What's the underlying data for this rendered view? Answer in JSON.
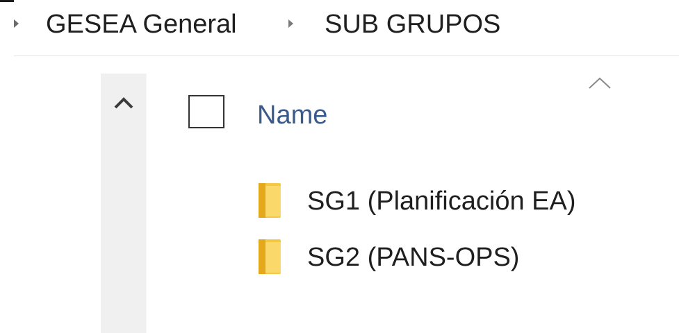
{
  "breadcrumb": {
    "items": [
      "GESEA General",
      "SUB GRUPOS"
    ]
  },
  "list": {
    "header": {
      "name_label": "Name"
    },
    "items": [
      {
        "name": "SG1 (Planificación EA)",
        "icon": "folder-icon"
      },
      {
        "name": "SG2 (PANS-OPS)",
        "icon": "folder-icon"
      }
    ]
  },
  "colors": {
    "header_text": "#3a5a8c",
    "folder": "#f5c842",
    "scrollbar_track": "#f0f0f0"
  }
}
